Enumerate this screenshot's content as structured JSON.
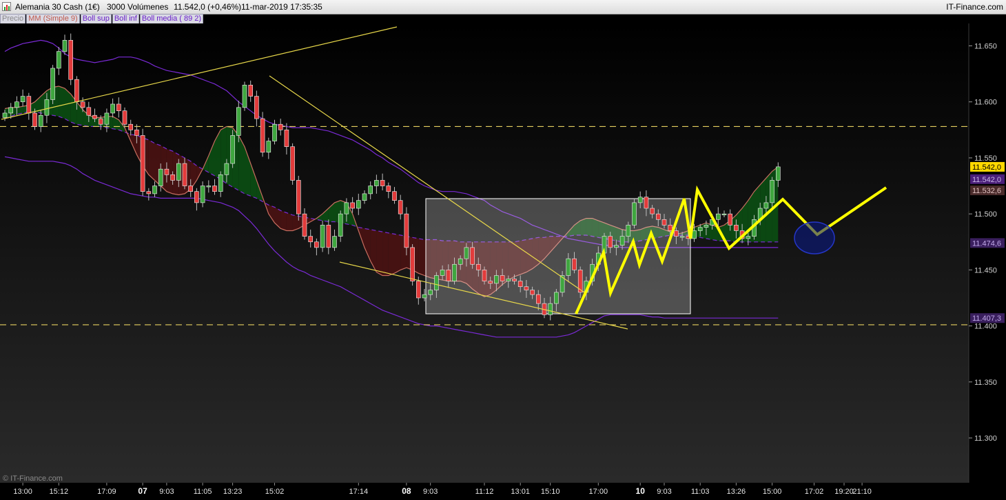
{
  "window": {
    "instrument": "Alemania 30 Cash (1€)",
    "volume": "3000 Volúmenes",
    "quote": "11.542,0 (+0,46%)",
    "datetime": "11-mar-2019 17:35:35",
    "brand": "IT-Finance.com"
  },
  "legend": [
    {
      "label": "Precio",
      "color": "#9a9a9a"
    },
    {
      "label": "MM (Simple 9)",
      "color": "#c86e60"
    },
    {
      "label": "Boll sup",
      "color": "#7a2ad6"
    },
    {
      "label": "Boll inf",
      "color": "#7a2ad6"
    },
    {
      "label": "Boll media ( 89 2)",
      "color": "#7a2ad6"
    }
  ],
  "watermark": "© IT-Finance.com",
  "colors": {
    "up_candle": "#3fa63f",
    "down_candle": "#e23b3b",
    "drawing": "#ffff00",
    "fine_line": "#e8d84a",
    "boll_band": "#7a2ad6",
    "sma": "#c86e60",
    "grid_dash": "#e6d060"
  },
  "chart_data": {
    "type": "candlestick",
    "title": "Alemania 30 Cash (1€)",
    "ylim": [
      11260,
      11670
    ],
    "y_ticks": [
      11300,
      11350,
      11400,
      11450,
      11500,
      11550,
      11600,
      11650
    ],
    "y_tick_labels": [
      "11.300",
      "11.350",
      "11.400",
      "11.450",
      "11.500",
      "11.550",
      "11.600",
      "11.650"
    ],
    "bar_count": 130,
    "x_labels": [
      {
        "i": 3,
        "label": "13:00",
        "day": false
      },
      {
        "i": 9,
        "label": "15:12",
        "day": false
      },
      {
        "i": 17,
        "label": "17:09",
        "day": false
      },
      {
        "i": 23,
        "label": "07",
        "day": true
      },
      {
        "i": 27,
        "label": "9:03",
        "day": false
      },
      {
        "i": 33,
        "label": "11:05",
        "day": false
      },
      {
        "i": 38,
        "label": "13:23",
        "day": false
      },
      {
        "i": 45,
        "label": "15:02",
        "day": false
      },
      {
        "i": 59,
        "label": "17:14",
        "day": false
      },
      {
        "i": 67,
        "label": "08",
        "day": true
      },
      {
        "i": 71,
        "label": "9:03",
        "day": false
      },
      {
        "i": 80,
        "label": "11:12",
        "day": false
      },
      {
        "i": 86,
        "label": "13:01",
        "day": false
      },
      {
        "i": 91,
        "label": "15:10",
        "day": false
      },
      {
        "i": 99,
        "label": "17:00",
        "day": false
      },
      {
        "i": 106,
        "label": "10",
        "day": true
      },
      {
        "i": 110,
        "label": "9:03",
        "day": false
      },
      {
        "i": 116,
        "label": "11:03",
        "day": false
      },
      {
        "i": 122,
        "label": "13:26",
        "day": false
      },
      {
        "i": 128,
        "label": "15:00",
        "day": false
      },
      {
        "i": 135,
        "label": "17:02",
        "day": false
      },
      {
        "i": 140,
        "label": "19:20",
        "day": false
      },
      {
        "i": 143,
        "label": "21:10",
        "day": false
      }
    ],
    "closes": [
      11590,
      11595,
      11600,
      11605,
      11590,
      11578,
      11588,
      11602,
      11630,
      11645,
      11655,
      11620,
      11600,
      11595,
      11588,
      11585,
      11580,
      11590,
      11598,
      11592,
      11580,
      11575,
      11570,
      11520,
      11518,
      11525,
      11540,
      11535,
      11530,
      11545,
      11525,
      11520,
      11510,
      11525,
      11525,
      11520,
      11535,
      11545,
      11570,
      11595,
      11615,
      11605,
      11585,
      11555,
      11565,
      11580,
      11575,
      11560,
      11530,
      11500,
      11480,
      11475,
      11470,
      11490,
      11470,
      11480,
      11500,
      11510,
      11505,
      11512,
      11518,
      11525,
      11530,
      11525,
      11520,
      11512,
      11500,
      11470,
      11440,
      11425,
      11428,
      11432,
      11445,
      11450,
      11440,
      11455,
      11460,
      11470,
      11455,
      11450,
      11440,
      11438,
      11445,
      11440,
      11442,
      11440,
      11435,
      11432,
      11428,
      11420,
      11410,
      11420,
      11430,
      11445,
      11460,
      11450,
      11430,
      11440,
      11455,
      11465,
      11480,
      11470,
      11472,
      11480,
      11490,
      11510,
      11515,
      11505,
      11500,
      11495,
      11490,
      11485,
      11480,
      11480,
      11478,
      11485,
      11488,
      11490,
      11495,
      11500,
      11500,
      11490,
      11485,
      11478,
      11480,
      11495,
      11505,
      11510,
      11530,
      11542
    ],
    "sma9": [
      11594,
      11595,
      11595,
      11596,
      11597,
      11600,
      11605,
      11610,
      11613,
      11614,
      11612,
      11607,
      11600,
      11593,
      11588,
      11586,
      11586,
      11587,
      11587,
      11584,
      11577,
      11565,
      11553,
      11543,
      11535,
      11530,
      11525,
      11520,
      11518,
      11517,
      11518,
      11522,
      11530,
      11540,
      11552,
      11565,
      11575,
      11578,
      11577,
      11570,
      11560,
      11545,
      11530,
      11515,
      11500,
      11492,
      11487,
      11485,
      11485,
      11487,
      11490,
      11493,
      11496,
      11500,
      11505,
      11510,
      11512,
      11510,
      11500,
      11485,
      11470,
      11458,
      11448,
      11445,
      11445,
      11447,
      11450,
      11452,
      11450,
      11447,
      11445,
      11443,
      11442,
      11441,
      11440,
      11440,
      11440,
      11438,
      11433,
      11429,
      11426,
      11428,
      11432,
      11437,
      11441,
      11444,
      11446,
      11448,
      11451,
      11455,
      11460,
      11466,
      11472,
      11478,
      11484,
      11490,
      11494,
      11496,
      11496,
      11494,
      11492,
      11490,
      11488,
      11486,
      11485,
      11485,
      11486,
      11488,
      11489,
      11488,
      11486,
      11484,
      11482,
      11483,
      11485,
      11488,
      11490,
      11492,
      11490,
      11488,
      11490,
      11494,
      11499,
      11505,
      11512,
      11520,
      11526,
      11532,
      11538,
      11542
    ],
    "boll_media": [
      11585,
      11587,
      11589,
      11590,
      11591,
      11591,
      11590,
      11589,
      11588,
      11587,
      11585,
      11582,
      11580,
      11579,
      11578,
      11578,
      11578,
      11577,
      11576,
      11575,
      11573,
      11571,
      11570,
      11568,
      11566,
      11563,
      11561,
      11558,
      11556,
      11553,
      11550,
      11547,
      11543,
      11540,
      11537,
      11534,
      11531,
      11527,
      11524,
      11521,
      11518,
      11516,
      11514,
      11511,
      11508,
      11506,
      11503,
      11501,
      11499,
      11498,
      11497,
      11496,
      11495,
      11494,
      11493,
      11493,
      11492,
      11491,
      11490,
      11488,
      11487,
      11486,
      11485,
      11484,
      11483,
      11482,
      11481,
      11480,
      11479,
      11478,
      11477,
      11477,
      11477,
      11476,
      11476,
      11476,
      11475,
      11475,
      11475,
      11475,
      11475,
      11475,
      11475,
      11475,
      11475,
      11475,
      11476,
      11477,
      11478,
      11479,
      11479,
      11480,
      11480,
      11480,
      11480,
      11481,
      11481,
      11481,
      11480,
      11479,
      11478,
      11477,
      11476,
      11475,
      11475,
      11475,
      11476,
      11477,
      11478,
      11479,
      11480,
      11481,
      11481,
      11481,
      11481,
      11480,
      11479,
      11478,
      11477,
      11476,
      11476,
      11476,
      11475,
      11475,
      11475,
      11475,
      11475,
      11475,
      11475,
      11475
    ],
    "boll_sup": [
      11645,
      11648,
      11650,
      11652,
      11653,
      11654,
      11655,
      11654,
      11652,
      11648,
      11643,
      11640,
      11638,
      11637,
      11636,
      11635,
      11636,
      11637,
      11638,
      11640,
      11640,
      11640,
      11639,
      11637,
      11635,
      11632,
      11630,
      11628,
      11627,
      11626,
      11625,
      11624,
      11622,
      11620,
      11618,
      11616,
      11613,
      11610,
      11605,
      11600,
      11596,
      11592,
      11588,
      11585,
      11582,
      11580,
      11579,
      11578,
      11577,
      11577,
      11577,
      11577,
      11576,
      11575,
      11574,
      11572,
      11570,
      11568,
      11566,
      11563,
      11560,
      11557,
      11553,
      11550,
      11546,
      11543,
      11540,
      11536,
      11532,
      11528,
      11525,
      11523,
      11521,
      11520,
      11520,
      11520,
      11519,
      11518,
      11516,
      11514,
      11512,
      11508,
      11505,
      11502,
      11500,
      11498,
      11496,
      11493,
      11490,
      11488,
      11486,
      11484,
      11482,
      11480,
      11478,
      11477,
      11476,
      11475,
      11474,
      11473,
      11472,
      11472,
      11471,
      11470,
      11470,
      11470,
      11470,
      11470,
      11470,
      11470,
      11470,
      11470,
      11470,
      11470,
      11470,
      11470,
      11470,
      11470,
      11470,
      11470,
      11470,
      11470,
      11470,
      11470,
      11470,
      11470,
      11470,
      11470,
      11470,
      11470
    ],
    "boll_inf": [
      11551,
      11550,
      11549,
      11548,
      11547,
      11547,
      11547,
      11547,
      11547,
      11546,
      11545,
      11543,
      11540,
      11536,
      11533,
      11530,
      11528,
      11526,
      11524,
      11522,
      11520,
      11518,
      11517,
      11516,
      11515,
      11515,
      11514,
      11514,
      11514,
      11514,
      11514,
      11514,
      11514,
      11513,
      11512,
      11511,
      11510,
      11508,
      11506,
      11503,
      11498,
      11493,
      11487,
      11480,
      11473,
      11467,
      11462,
      11457,
      11453,
      11450,
      11448,
      11445,
      11443,
      11441,
      11439,
      11437,
      11435,
      11432,
      11429,
      11426,
      11423,
      11420,
      11417,
      11414,
      11412,
      11410,
      11408,
      11406,
      11404,
      11402,
      11401,
      11400,
      11400,
      11399,
      11398,
      11397,
      11396,
      11395,
      11394,
      11393,
      11392,
      11391,
      11390,
      11390,
      11390,
      11390,
      11390,
      11390,
      11390,
      11390,
      11390,
      11390,
      11390,
      11391,
      11392,
      11394,
      11397,
      11400,
      11403,
      11406,
      11409,
      11410,
      11410,
      11410,
      11410,
      11410,
      11410,
      11409,
      11408,
      11408,
      11407,
      11407,
      11407,
      11407,
      11407,
      11407,
      11407,
      11407,
      11407,
      11407,
      11407,
      11407,
      11407,
      11407,
      11407,
      11407,
      11407,
      11407,
      11407,
      11407
    ],
    "horizontal_levels": [
      11578,
      11401
    ],
    "price_tags": [
      {
        "label": "11.542,0",
        "value": 11542,
        "bg": "#ffd800",
        "fg": "#000000"
      },
      {
        "label": "11.542,0",
        "value": 11531,
        "bg": "#4a1f7a",
        "fg": "#c8b6e6"
      },
      {
        "label": "11.532,6",
        "value": 11521,
        "bg": "#4a2b2b",
        "fg": "#e0c0c0"
      },
      {
        "label": "11.474,6",
        "value": 11474,
        "bg": "#3a1f5e",
        "fg": "#c0a8e8"
      },
      {
        "label": "11.407,3",
        "value": 11407,
        "bg": "#3a1f5e",
        "fg": "#c0a8e8"
      }
    ]
  }
}
